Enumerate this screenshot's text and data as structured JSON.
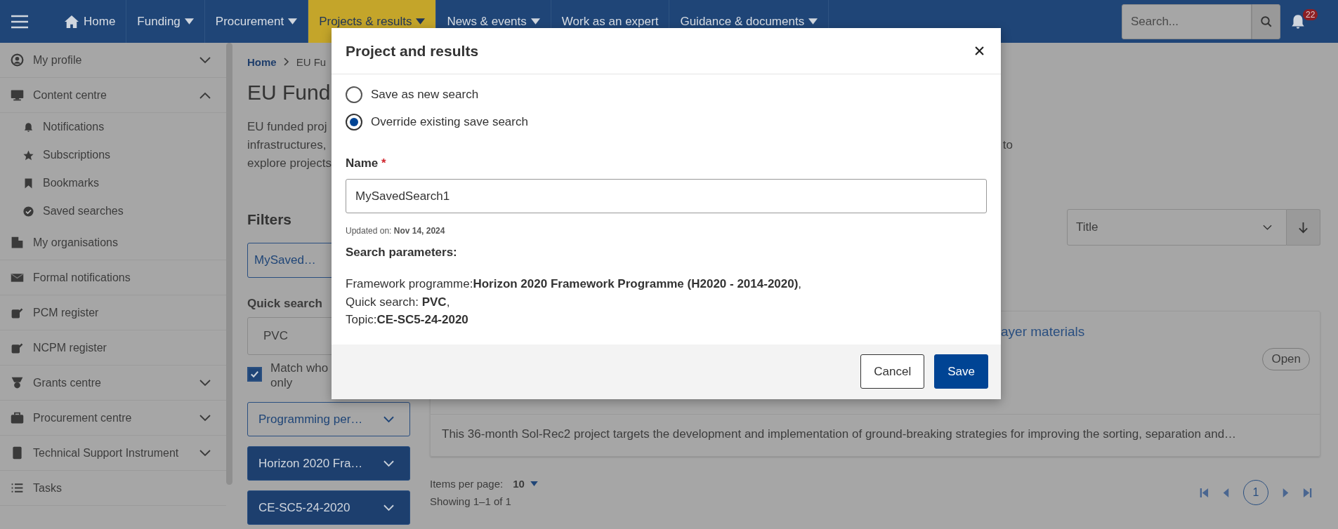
{
  "nav": {
    "items": [
      {
        "label": "Home",
        "dropdown": false,
        "selected": false
      },
      {
        "label": "Funding",
        "dropdown": true,
        "selected": false
      },
      {
        "label": "Procurement",
        "dropdown": true,
        "selected": false
      },
      {
        "label": "Projects & results",
        "dropdown": true,
        "selected": true
      },
      {
        "label": "News & events",
        "dropdown": true,
        "selected": false
      },
      {
        "label": "Work as an expert",
        "dropdown": false,
        "selected": false
      },
      {
        "label": "Guidance & documents",
        "dropdown": true,
        "selected": false
      }
    ],
    "search": {
      "placeholder": "Search..."
    },
    "notifications": "22"
  },
  "sidebar": {
    "items": [
      {
        "label": "My profile",
        "expanded": false
      },
      {
        "label": "Content centre",
        "expanded": true,
        "children": [
          {
            "label": "Notifications"
          },
          {
            "label": "Subscriptions"
          },
          {
            "label": "Bookmarks"
          },
          {
            "label": "Saved searches"
          }
        ]
      },
      {
        "label": "My organisations"
      },
      {
        "label": "Formal notifications"
      },
      {
        "label": "PCM register"
      },
      {
        "label": "NCPM register"
      },
      {
        "label": "Grants centre",
        "expanded": false
      },
      {
        "label": "Procurement centre",
        "expanded": false
      },
      {
        "label": "Technical Support Instrument",
        "expanded": false
      },
      {
        "label": "Tasks"
      }
    ]
  },
  "breadcrumb": [
    "Home",
    "EU Fu"
  ],
  "page_title": "EU Fund",
  "description": {
    "lines": [
      "EU funded proj",
      "infrastructures,",
      "explore projects"
    ],
    "line_2_end": "to"
  },
  "filters": {
    "heading": "Filters",
    "saved_search": "MySaved…",
    "quick_search_label": "Quick search",
    "quick_search_value": "PVC",
    "match": {
      "label": "Match who only",
      "checked": true
    },
    "dropdowns": [
      {
        "label": "Programming per…",
        "active": false
      },
      {
        "label": "Horizon 2020 Fra…",
        "active": true
      },
      {
        "label": "CE-SC5-24-2020",
        "active": true
      }
    ]
  },
  "results": {
    "sort": {
      "value": "Title"
    },
    "card": {
      "title": "ayer materials",
      "status": "Open",
      "description": "This 36-month Sol-Rec2 project targets the development and implementation of ground-breaking strategies for improving the sorting, separation and…"
    },
    "items_per_page_label": "Items per page:",
    "items_per_page": "10",
    "showing": "Showing 1–1 of 1",
    "pages": [
      {
        "label": "1",
        "selected": true
      }
    ]
  },
  "modal": {
    "title": "Project and results",
    "options": [
      {
        "label": "Save as new search",
        "selected": false
      },
      {
        "label": "Override existing save search",
        "selected": true
      }
    ],
    "name_label": "Name",
    "required_mark": "*",
    "name_value": "MySavedSearch1",
    "updated": "Updated on: **Nov 14, 2024**",
    "params_heading": "Search parameters:",
    "params": [
      "Framework programme:**Horizon 2020 Framework Programme (H2020 - 2014-2020)**,",
      "Quick search: **PVC**,",
      "Topic:**CE-SC5-24-2020**"
    ],
    "buttons": {
      "cancel": "Cancel",
      "save": "Save"
    }
  }
}
